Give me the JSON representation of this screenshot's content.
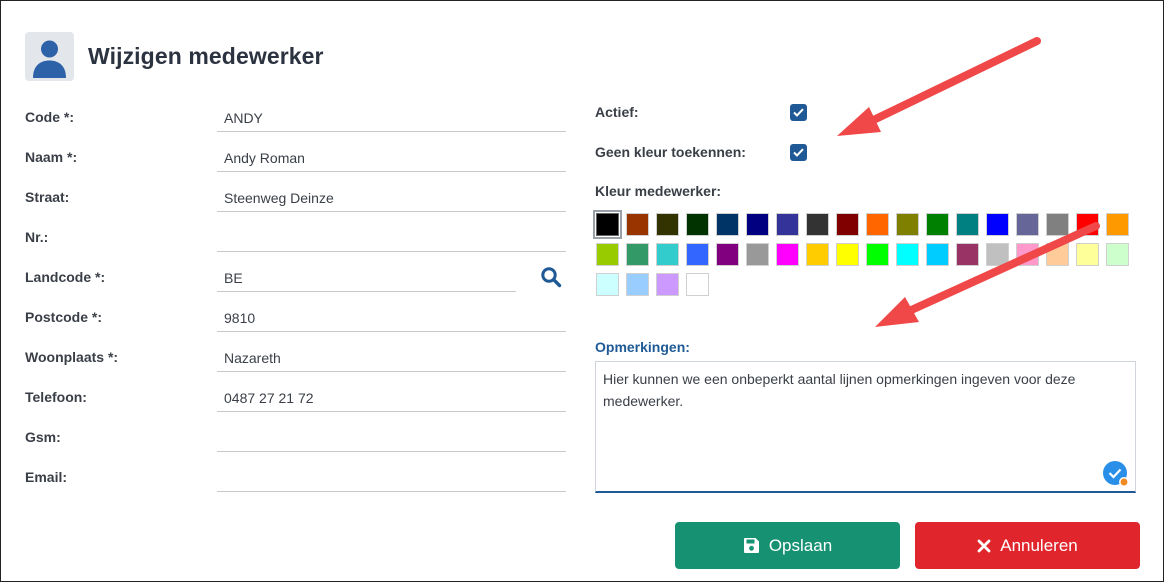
{
  "header": {
    "title": "Wijzigen medewerker",
    "avatar_icon": "user-icon"
  },
  "form": {
    "fields": [
      {
        "label": "Code *:",
        "value": "ANDY"
      },
      {
        "label": "Naam *:",
        "value": "Andy Roman"
      },
      {
        "label": "Straat:",
        "value": "Steenweg Deinze"
      },
      {
        "label": "Nr.:",
        "value": ""
      },
      {
        "label": "Landcode *:",
        "value": "BE"
      },
      {
        "label": "Postcode *:",
        "value": "9810"
      },
      {
        "label": "Woonplaats *:",
        "value": "Nazareth"
      },
      {
        "label": "Telefoon:",
        "value": "0487 27 21 72"
      },
      {
        "label": "Gsm:",
        "value": ""
      },
      {
        "label": "Email:",
        "value": ""
      }
    ],
    "search_icon": "search-icon"
  },
  "right": {
    "actief_label": "Actief:",
    "actief_checked": true,
    "geen_kleur_label": "Geen kleur toekennen:",
    "geen_kleur_checked": true,
    "kleur_label": "Kleur medewerker:",
    "colors": [
      "#000000",
      "#993300",
      "#333300",
      "#003300",
      "#003366",
      "#000080",
      "#333399",
      "#333333",
      "#800000",
      "#ff6600",
      "#808000",
      "#008000",
      "#008080",
      "#0000ff",
      "#666699",
      "#808080",
      "#ff0000",
      "#ff9900",
      "#99cc00",
      "#339966",
      "#33cccc",
      "#3366ff",
      "#800080",
      "#999999",
      "#ff00ff",
      "#ffcc00",
      "#ffff00",
      "#00ff00",
      "#00ffff",
      "#00ccff",
      "#993366",
      "#c0c0c0",
      "#ff99cc",
      "#ffcc99",
      "#ffff99",
      "#ccffcc",
      "#ccffff",
      "#99ccff",
      "#cc99ff",
      "#ffffff"
    ],
    "selected_color_index": 0,
    "remarks_label": "Opmerkingen:",
    "remarks_text": "Hier kunnen we een onbeperkt aantal lijnen opmerkingen ingeven voor deze medewerker."
  },
  "buttons": {
    "save_label": "Opslaan",
    "cancel_label": "Annuleren",
    "save_color": "#169172",
    "cancel_color": "#e0262c"
  },
  "annotations": {
    "arrow_color": "#f04848"
  }
}
